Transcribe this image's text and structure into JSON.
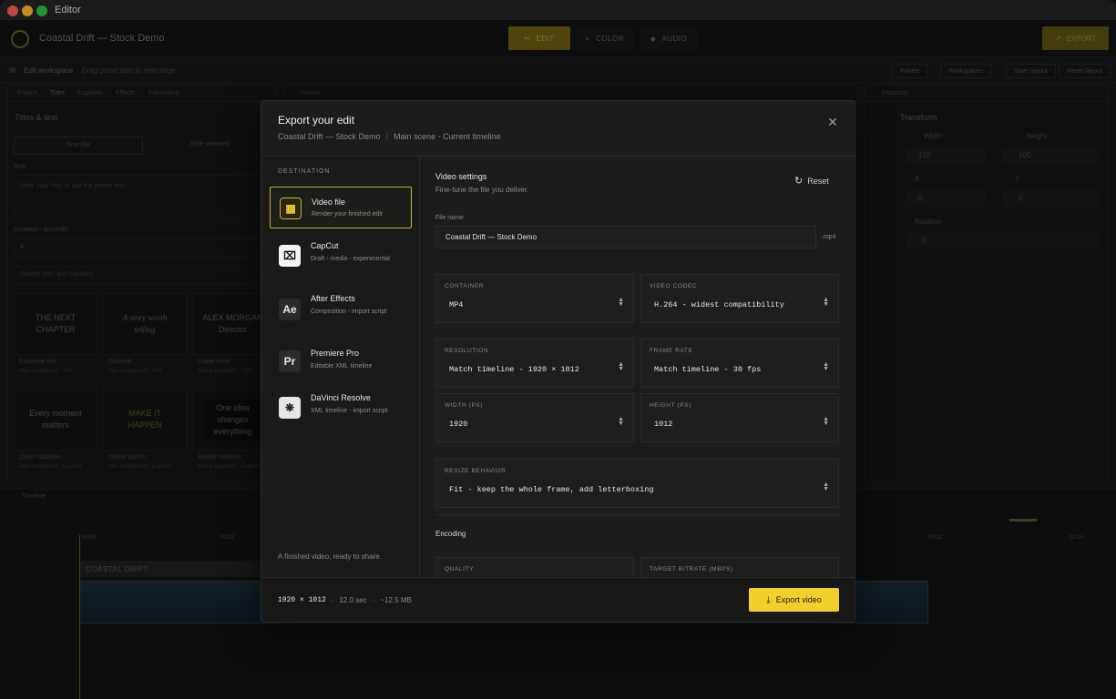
{
  "window": {
    "title": "Editor"
  },
  "app": {
    "project_title": "Coastal Drift — Stock Demo",
    "modes": [
      "EDIT",
      "COLOR",
      "AUDIO"
    ],
    "export_label": "EXPORT"
  },
  "workspace": {
    "title": "Edit workspace",
    "hint": "Drag panel tabs to rearrange",
    "buttons": [
      "Panels",
      "Workspaces",
      "Save layout",
      "Reset layout"
    ]
  },
  "left_panel": {
    "tabs": [
      "Project",
      "Titles",
      "Captions",
      "Effects",
      "Transitions"
    ],
    "heading": "Titles & text",
    "new_title": "New title",
    "style_selected": "Style selected",
    "text_label": "Text",
    "text_placeholder": "Write your title, or use the preset text",
    "duration_label": "Duration - seconds",
    "duration_value": "4",
    "search_placeholder": "Search titles and captions",
    "tiles": [
      {
        "text": "THE NEXT CHAPTER",
        "name": "Essential title",
        "meta": "Add at playback · Title"
      },
      {
        "text": "A story worth telling",
        "name": "Editorial",
        "meta": "Add at playback · Title"
      },
      {
        "text": "ALEX MORGAN Director",
        "name": "Lower third",
        "meta": "Add at playback · Title"
      },
      {
        "text": "Every moment matters",
        "name": "Clean subtitles",
        "meta": "Add at playback · Caption"
      },
      {
        "text": "MAKE IT HAPPEN",
        "name": "Yellow punch",
        "meta": "Add at playback · Caption"
      },
      {
        "text": "One idea changes everything",
        "name": "Boxed captions",
        "meta": "Add at playback · Caption"
      }
    ]
  },
  "viewer": {
    "tab": "Viewer"
  },
  "inspector": {
    "tab": "Inspector",
    "section": "Transform",
    "width_label": "Width",
    "width_value": "100",
    "height_label": "Height",
    "height_value": "100",
    "x_label": "X",
    "x_value": "0",
    "y_label": "Y",
    "y_value": "0",
    "rotation_label": "Rotation",
    "rotation_value": "0"
  },
  "timeline": {
    "tab": "Timeline",
    "ticks": [
      "00:00",
      "00:02",
      "00:12",
      "00:14"
    ],
    "title_clip": "COASTAL DRIFT"
  },
  "modal": {
    "title": "Export your edit",
    "breadcrumb": [
      "Coastal Drift — Stock Demo",
      "/",
      "Main scene - Current timeline"
    ],
    "destination_header": "DESTINATION",
    "destinations": [
      {
        "name": "Video file",
        "desc": "Render your finished edit",
        "icon": "film-icon"
      },
      {
        "name": "CapCut",
        "desc": "Draft - media - experimental",
        "icon": "capcut-icon"
      },
      {
        "name": "After Effects",
        "desc": "Composition - import script",
        "icon": "after-effects-icon"
      },
      {
        "name": "Premiere Pro",
        "desc": "Editable XML timeline",
        "icon": "premiere-pro-icon"
      },
      {
        "name": "DaVinci Resolve",
        "desc": "XML timeline - import script",
        "icon": "davinci-resolve-icon"
      }
    ],
    "destination_footer": "A finished video, ready to share.",
    "settings": {
      "title": "Video settings",
      "subtitle": "Fine-tune the file you deliver.",
      "reset": "Reset",
      "file_name_label": "File name",
      "file_name_value": "Coastal Drift — Stock Demo",
      "file_ext": ".mp4",
      "container_label": "CONTAINER",
      "container_value": "MP4",
      "codec_label": "VIDEO CODEC",
      "codec_value": "H.264 - widest compatibility",
      "resolution_label": "RESOLUTION",
      "resolution_value": "Match timeline - 1920 × 1012",
      "framerate_label": "FRAME RATE",
      "framerate_value": "Match timeline - 30 fps",
      "width_label": "WIDTH (PX)",
      "width_value": "1920",
      "height_label": "HEIGHT (PX)",
      "height_value": "1012",
      "resize_label": "RESIZE BEHAVIOR",
      "resize_value": "Fit - keep the whole frame, add letterboxing",
      "encoding_title": "Encoding",
      "quality_label": "QUALITY",
      "bitrate_label": "TARGET BITRATE (MBPS)"
    },
    "footer": {
      "resolution": "1920 × 1012",
      "duration": "12.0 sec",
      "size": "~12.5 MB",
      "sep": "·",
      "export_button": "Export video"
    }
  },
  "colors": {
    "accent": "#f2cf2b",
    "background": "#161616",
    "modal": "#1c1c1c"
  }
}
